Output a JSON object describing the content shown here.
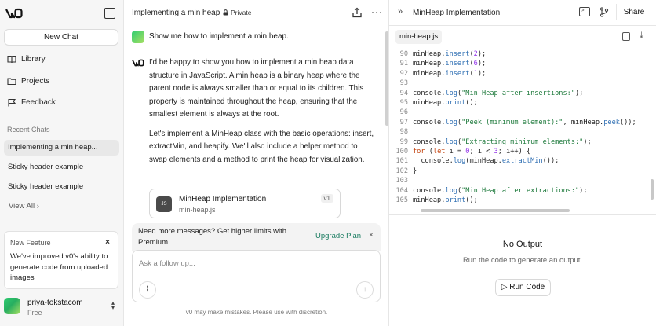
{
  "sidebar": {
    "logo": "v0",
    "new_chat_label": "New Chat",
    "nav": [
      {
        "label": "Library",
        "icon": "book-icon"
      },
      {
        "label": "Projects",
        "icon": "folder-icon"
      },
      {
        "label": "Feedback",
        "icon": "flag-icon"
      }
    ],
    "recent_label": "Recent Chats",
    "recent_chats": [
      {
        "label": "Implementing a min heap...",
        "active": true
      },
      {
        "label": "Sticky header example",
        "active": false
      },
      {
        "label": "Sticky header example",
        "active": false
      }
    ],
    "view_all_label": "View All",
    "feature": {
      "title": "New Feature",
      "close": "×",
      "body": "We've improved v0's ability to generate code from uploaded images"
    },
    "user": {
      "name": "priya-tokstacom",
      "plan": "Free"
    }
  },
  "chat": {
    "title": "Implementing a min heap",
    "private_label": "Private",
    "user_message": "Show me how to implement a min heap.",
    "bot_paragraphs": [
      "I'd be happy to show you how to implement a min heap data structure in JavaScript. A min heap is a binary heap where the parent node is always smaller than or equal to its children. This property is maintained throughout the heap, ensuring that the smallest element is always at the root.",
      "Let's implement a MinHeap class with the basic operations: insert, extractMin, and heapify. We'll also include a helper method to swap elements and a method to print the heap for visualization."
    ],
    "artifact": {
      "title": "MinHeap Implementation",
      "file": "min-heap.js",
      "version": "v1",
      "icon_text": "JS"
    },
    "limit_banner": {
      "text": "Need more messages? Get higher limits with Premium.",
      "upgrade_label": "Upgrade Plan",
      "close": "×"
    },
    "input_placeholder": "Ask a follow up...",
    "disclaimer": "v0 may make mistakes. Please use with discretion."
  },
  "code_panel": {
    "title": "MinHeap Implementation",
    "share_label": "Share",
    "file_tab": "min-heap.js",
    "lines": [
      {
        "n": "90",
        "tokens": [
          [
            "minHeap.",
            "plain"
          ],
          [
            "insert",
            "fn"
          ],
          [
            "(",
            "plain"
          ],
          [
            "2",
            "num"
          ],
          [
            ");",
            "plain"
          ]
        ]
      },
      {
        "n": "91",
        "tokens": [
          [
            "minHeap.",
            "plain"
          ],
          [
            "insert",
            "fn"
          ],
          [
            "(",
            "plain"
          ],
          [
            "6",
            "num"
          ],
          [
            ");",
            "plain"
          ]
        ]
      },
      {
        "n": "92",
        "tokens": [
          [
            "minHeap.",
            "plain"
          ],
          [
            "insert",
            "fn"
          ],
          [
            "(",
            "plain"
          ],
          [
            "1",
            "num"
          ],
          [
            ");",
            "plain"
          ]
        ]
      },
      {
        "n": "93",
        "tokens": []
      },
      {
        "n": "94",
        "tokens": [
          [
            "console.",
            "plain"
          ],
          [
            "log",
            "fn"
          ],
          [
            "(",
            "plain"
          ],
          [
            "\"Min Heap after insertions:\"",
            "str"
          ],
          [
            ");",
            "plain"
          ]
        ]
      },
      {
        "n": "95",
        "tokens": [
          [
            "minHeap.",
            "plain"
          ],
          [
            "print",
            "fn"
          ],
          [
            "();",
            "plain"
          ]
        ]
      },
      {
        "n": "96",
        "tokens": []
      },
      {
        "n": "97",
        "tokens": [
          [
            "console.",
            "plain"
          ],
          [
            "log",
            "fn"
          ],
          [
            "(",
            "plain"
          ],
          [
            "\"Peek (minimum element):\"",
            "str"
          ],
          [
            ", minHeap.",
            "plain"
          ],
          [
            "peek",
            "fn"
          ],
          [
            "());",
            "plain"
          ]
        ]
      },
      {
        "n": "98",
        "tokens": []
      },
      {
        "n": "99",
        "tokens": [
          [
            "console.",
            "plain"
          ],
          [
            "log",
            "fn"
          ],
          [
            "(",
            "plain"
          ],
          [
            "\"Extracting minimum elements:\"",
            "str"
          ],
          [
            ");",
            "plain"
          ]
        ]
      },
      {
        "n": "100",
        "tokens": [
          [
            "for",
            "kw"
          ],
          [
            " (",
            "plain"
          ],
          [
            "let",
            "kw"
          ],
          [
            " i = ",
            "plain"
          ],
          [
            "0",
            "num"
          ],
          [
            "; i < ",
            "plain"
          ],
          [
            "3",
            "num"
          ],
          [
            "; i++) {",
            "plain"
          ]
        ]
      },
      {
        "n": "101",
        "tokens": [
          [
            "  console.",
            "plain"
          ],
          [
            "log",
            "fn"
          ],
          [
            "(minHeap.",
            "plain"
          ],
          [
            "extractMin",
            "fn"
          ],
          [
            "());",
            "plain"
          ]
        ]
      },
      {
        "n": "102",
        "tokens": [
          [
            "}",
            "plain"
          ]
        ]
      },
      {
        "n": "103",
        "tokens": []
      },
      {
        "n": "104",
        "tokens": [
          [
            "console.",
            "plain"
          ],
          [
            "log",
            "fn"
          ],
          [
            "(",
            "plain"
          ],
          [
            "\"Min Heap after extractions:\"",
            "str"
          ],
          [
            ");",
            "plain"
          ]
        ]
      },
      {
        "n": "105",
        "tokens": [
          [
            "minHeap.",
            "plain"
          ],
          [
            "print",
            "fn"
          ],
          [
            "();",
            "plain"
          ]
        ]
      }
    ],
    "output_title": "No Output",
    "output_sub": "Run the code to generate an output.",
    "run_label": "Run Code"
  }
}
